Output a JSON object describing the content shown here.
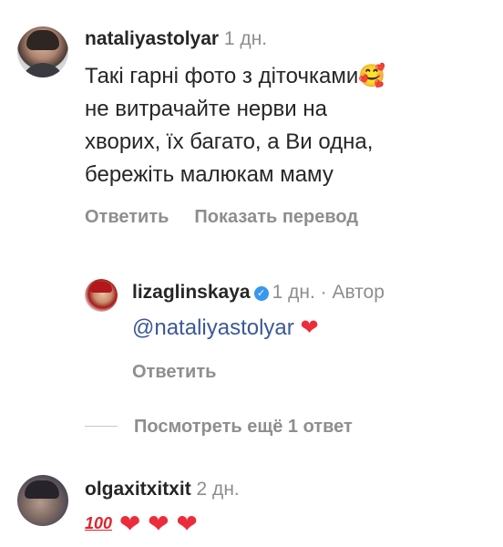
{
  "comment1": {
    "username": "nataliyastolyar",
    "time": "1 дн.",
    "text_lines": [
      "Такі гарні фото з діточками🥰",
      "не витрачайте нерви на",
      "хворих, їх багато, а Ви одна,",
      "бережіть малюкам маму"
    ],
    "reply_label": "Ответить",
    "translate_label": "Показать перевод"
  },
  "reply1": {
    "username": "lizaglinskaya",
    "verified_glyph": "✓",
    "time": "1 дн.",
    "separator": "·",
    "author_label": "Автор",
    "mention": "@nataliyastolyar",
    "heart": "❤",
    "reply_label": "Ответить"
  },
  "view_more_label": "Посмотреть ещё 1 ответ",
  "comment2": {
    "username": "olgaxitxitxit",
    "time": "2 дн.",
    "hundred": "100",
    "hearts": [
      "❤",
      "❤",
      "❤"
    ]
  },
  "colors": {
    "text": "#262626",
    "secondary": "#8e8e8e",
    "mention": "#3b5998",
    "heart": "#ed2c3b",
    "verified": "#3897f0"
  },
  "icons": [
    "verified-badge-icon",
    "heart-icon",
    "hundred-points-icon",
    "smiling-face-with-hearts-icon"
  ]
}
